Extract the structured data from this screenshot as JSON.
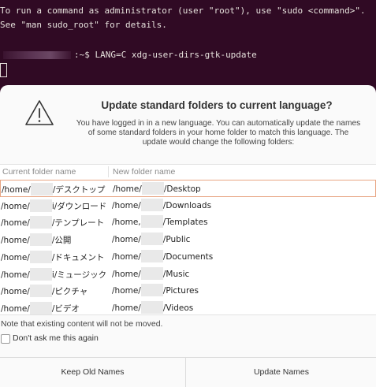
{
  "terminal": {
    "line1": "To run a command as administrator (user \"root\"), use \"sudo <command>\".",
    "line2": "See \"man sudo_root\" for details.",
    "prompt_suffix": ":~$ ",
    "command": "LANG=C xdg-user-dirs-gtk-update"
  },
  "dialog": {
    "title": "Update standard folders to current language?",
    "message": "You have logged in in a new language. You can automatically update the names of some standard folders in your home folder to match this language. The update would change the following folders:",
    "table": {
      "headers": [
        "Current folder name",
        "New folder name"
      ],
      "rows": [
        {
          "current_prefix": "/home/",
          "current_suffix": "/デスクトップ",
          "new_prefix": "/home/",
          "new_suffix": "/Desktop"
        },
        {
          "current_prefix": "/home/",
          "current_suffix": "i/ダウンロード",
          "new_prefix": "/home/",
          "new_suffix": "/Downloads"
        },
        {
          "current_prefix": "/home/",
          "current_suffix": "/テンプレート",
          "new_prefix": "/home,",
          "new_suffix": "/Templates"
        },
        {
          "current_prefix": "/home/",
          "current_suffix": "/公開",
          "new_prefix": "/home/",
          "new_suffix": "/Public"
        },
        {
          "current_prefix": "/home/",
          "current_suffix": "/ドキュメント",
          "new_prefix": "/home/",
          "new_suffix": "/Documents"
        },
        {
          "current_prefix": "/home/",
          "current_suffix": "i/ミュージック",
          "new_prefix": "/home/",
          "new_suffix": "/Music"
        },
        {
          "current_prefix": "/home/",
          "current_suffix": "/ピクチャ",
          "new_prefix": "/home/",
          "new_suffix": "/Pictures"
        },
        {
          "current_prefix": "/home/",
          "current_suffix": "/ビデオ",
          "new_prefix": "/home/",
          "new_suffix": "/Videos"
        }
      ]
    },
    "note": "Note that existing content will not be moved.",
    "checkbox_label": "Don't ask me this again",
    "checkbox_checked": false,
    "buttons": {
      "keep": "Keep Old Names",
      "update": "Update Names"
    },
    "colors": {
      "selected_row_border": "#e8a583",
      "terminal_bg": "#300a24"
    },
    "icon": "warning-triangle-icon"
  }
}
